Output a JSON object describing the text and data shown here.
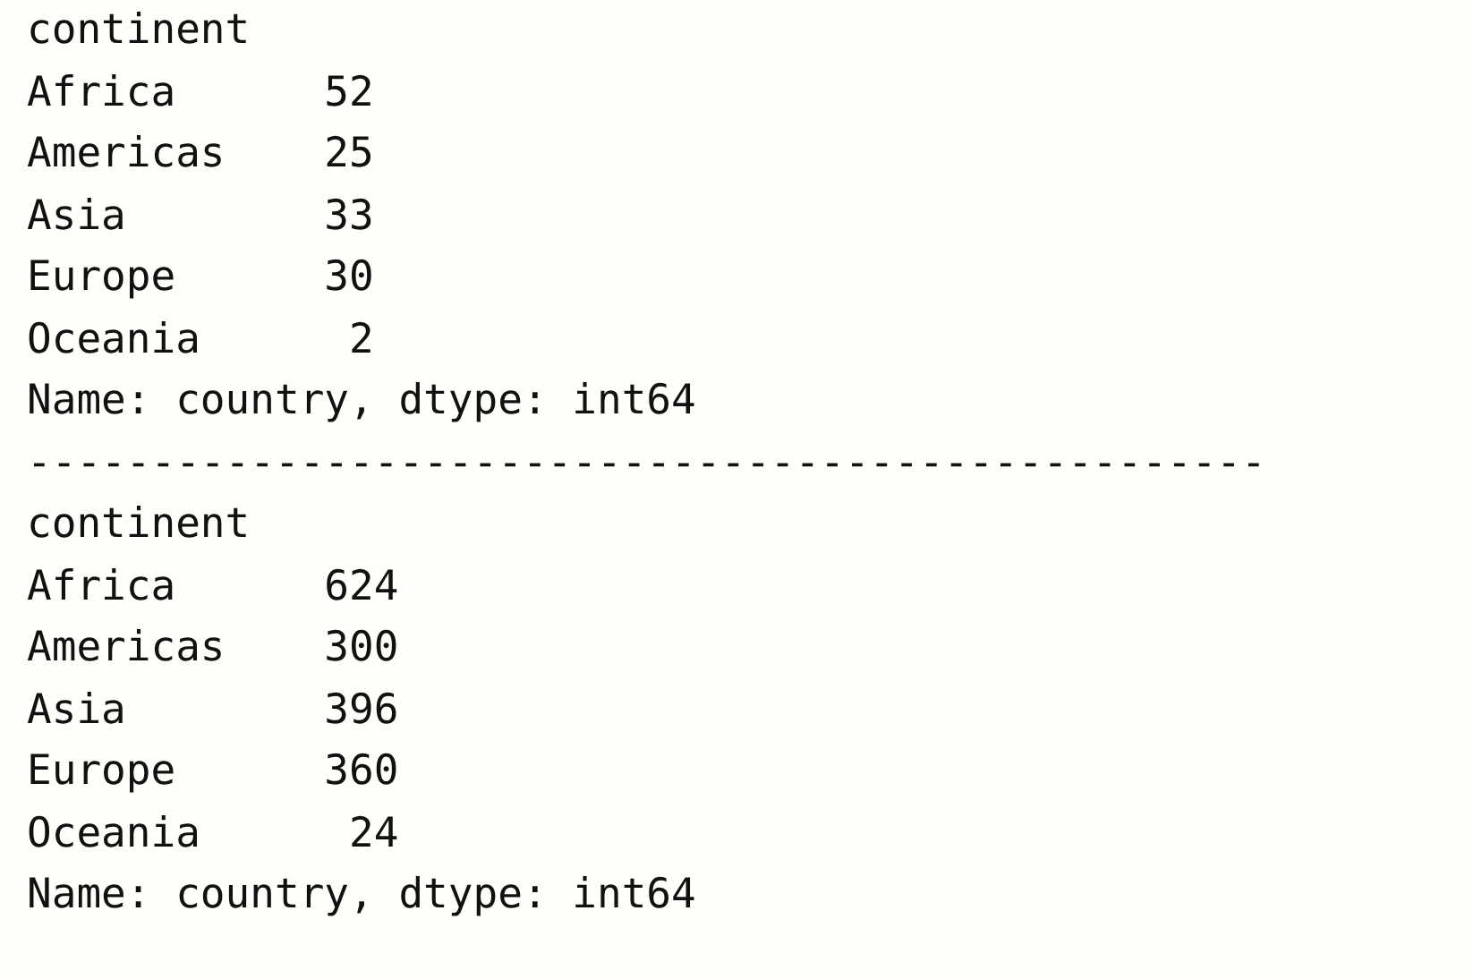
{
  "outputs": [
    {
      "index_name": "continent",
      "rows": [
        {
          "label": "Africa",
          "value": "52"
        },
        {
          "label": "Americas",
          "value": "25"
        },
        {
          "label": "Asia",
          "value": "33"
        },
        {
          "label": "Europe",
          "value": "30"
        },
        {
          "label": "Oceania",
          "value": "2"
        }
      ],
      "footer": "Name: country, dtype: int64"
    },
    {
      "index_name": "continent",
      "rows": [
        {
          "label": "Africa",
          "value": "624"
        },
        {
          "label": "Americas",
          "value": "300"
        },
        {
          "label": "Asia",
          "value": "396"
        },
        {
          "label": "Europe",
          "value": "360"
        },
        {
          "label": "Oceania",
          "value": "24"
        }
      ],
      "footer": "Name: country, dtype: int64"
    }
  ],
  "separator": "--------------------------------------------------"
}
